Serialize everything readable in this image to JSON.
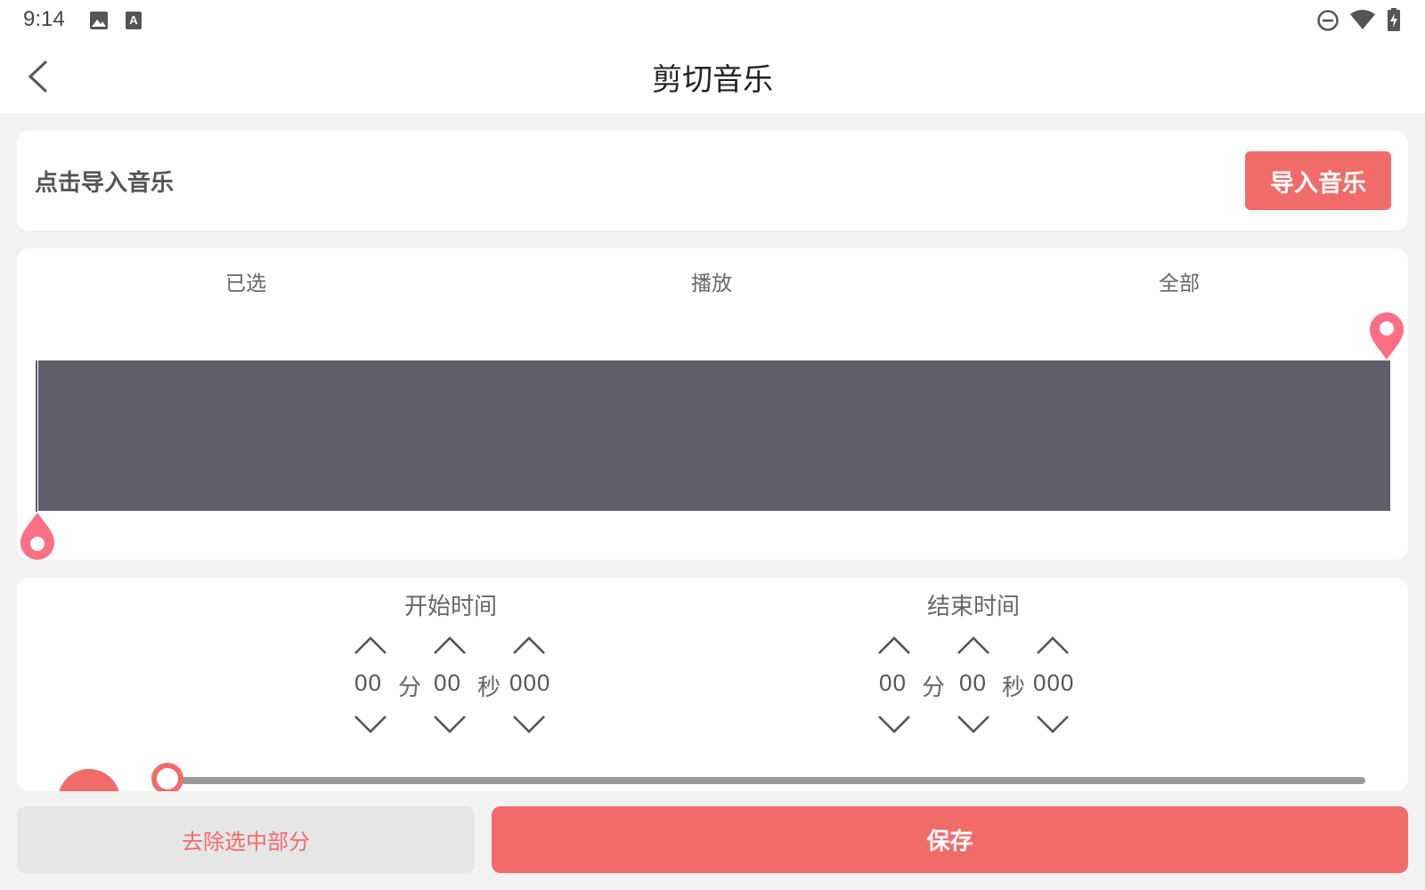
{
  "status_bar": {
    "time": "9:14",
    "icons": [
      "image-icon",
      "a-icon",
      "dnd-icon",
      "wifi-icon",
      "battery-charging-icon"
    ]
  },
  "app_bar": {
    "title": "剪切音乐",
    "back_icon": "back-chevron-icon"
  },
  "import_card": {
    "label": "点击导入音乐",
    "button_label": "导入音乐"
  },
  "wave_card": {
    "tabs": [
      {
        "label": "已选"
      },
      {
        "label": "播放"
      },
      {
        "label": "全部"
      }
    ],
    "waveform_color": "#5f5e6b",
    "marker_color": "#fd6f85",
    "selection_start_fraction": 0.0,
    "selection_end_fraction": 1.0
  },
  "time_card": {
    "start": {
      "title": "开始时间",
      "minutes": "00",
      "minute_unit": "分",
      "seconds": "00",
      "second_unit": "秒",
      "millis": "000"
    },
    "end": {
      "title": "结束时间",
      "minutes": "00",
      "minute_unit": "分",
      "seconds": "00",
      "second_unit": "秒",
      "millis": "000"
    },
    "progress_fraction": 0.0
  },
  "bottom": {
    "remove_label": "去除选中部分",
    "save_label": "保存"
  },
  "colors": {
    "accent": "#f26b6b",
    "background": "#f2f2f2",
    "card": "#ffffff"
  }
}
